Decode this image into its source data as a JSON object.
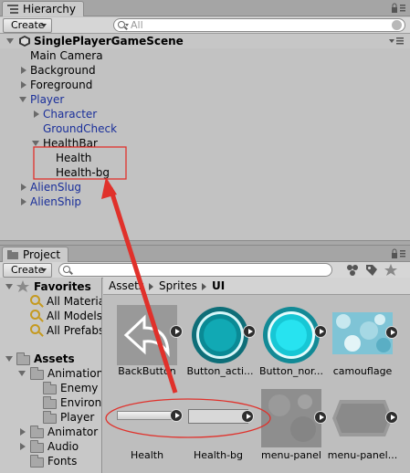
{
  "hierarchy": {
    "tab_label": "Hierarchy",
    "create_label": "Create",
    "search_placeholder": "All",
    "scene_name": "SinglePlayerGameScene",
    "items": [
      {
        "label": "Main Camera",
        "color": "#000000"
      },
      {
        "label": "Background",
        "color": "#000000"
      },
      {
        "label": "Foreground",
        "color": "#000000"
      },
      {
        "label": "Player",
        "color": "#1a2f9a"
      },
      {
        "label": "Character",
        "color": "#1a2f9a"
      },
      {
        "label": "GroundCheck",
        "color": "#1a2f9a"
      },
      {
        "label": "HealthBar",
        "color": "#000000"
      },
      {
        "label": "Health",
        "color": "#000000"
      },
      {
        "label": "Health-bg",
        "color": "#000000"
      },
      {
        "label": "AlienSlug",
        "color": "#1a2f9a"
      },
      {
        "label": "AlienShip",
        "color": "#1a2f9a"
      }
    ]
  },
  "project": {
    "tab_label": "Project",
    "create_label": "Create",
    "favorites": {
      "label": "Favorites",
      "items": [
        "All Materia",
        "All Models",
        "All Prefabs"
      ]
    },
    "assets": {
      "label": "Assets",
      "folders": [
        "Animation",
        "Enemy",
        "Environn",
        "Player",
        "Animator",
        "Audio",
        "Fonts"
      ]
    },
    "breadcrumb": [
      "Assets",
      "Sprites",
      "UI"
    ],
    "files": [
      {
        "label": "BackButton"
      },
      {
        "label": "Button_acti..."
      },
      {
        "label": "Button_nor..."
      },
      {
        "label": "camouflage"
      },
      {
        "label": "Health"
      },
      {
        "label": "Health-bg"
      },
      {
        "label": "menu-panel"
      },
      {
        "label": "menu-panel..."
      }
    ]
  },
  "colors": {
    "prefab_blue": "#1a2f9a",
    "annotation_red": "#e0312b",
    "selection": "#3e7ddf"
  }
}
